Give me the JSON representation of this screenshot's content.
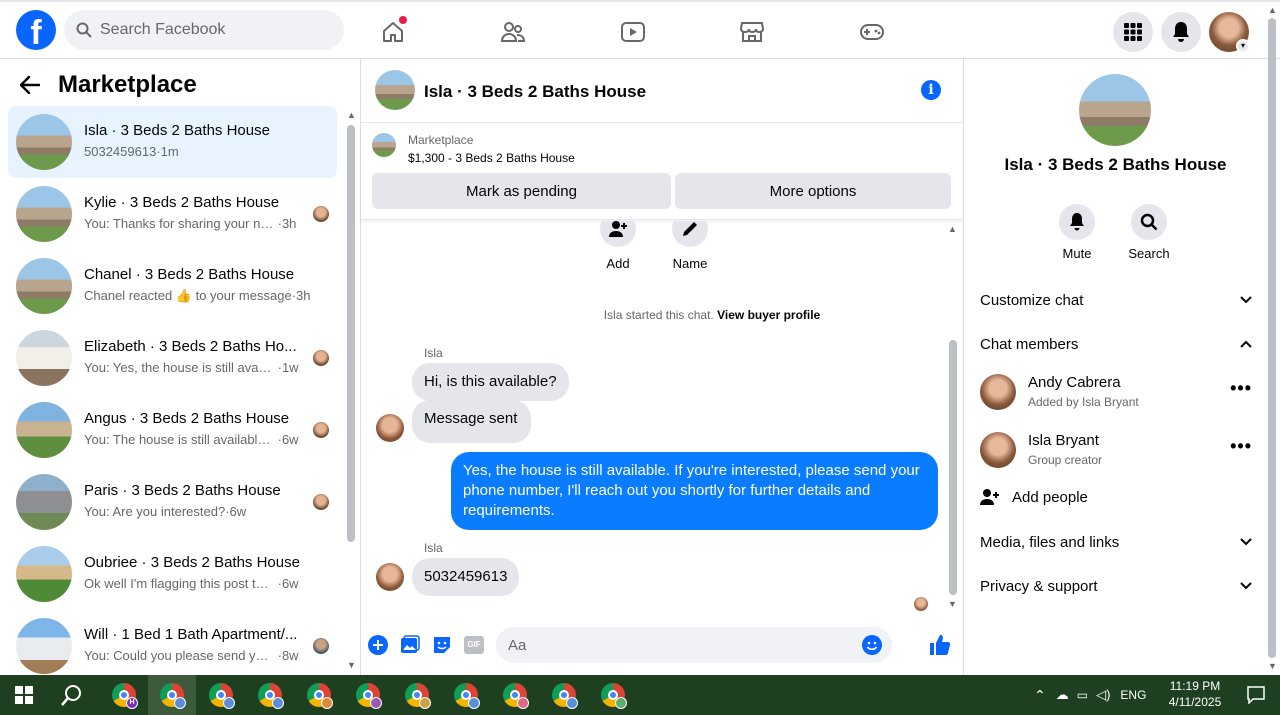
{
  "header": {
    "search_placeholder": "Search Facebook",
    "nav_icons": [
      "home-icon",
      "friends-icon",
      "video-icon",
      "marketplace-icon",
      "gaming-icon"
    ],
    "right_icons": [
      "menu-grid-icon",
      "notifications-icon",
      "account-avatar"
    ]
  },
  "left": {
    "title": "Marketplace",
    "conversations": [
      {
        "title": "Isla · 3 Beds 2 Baths House",
        "preview": "5032459613",
        "time": "1m",
        "active": true
      },
      {
        "title": "Kylie · 3 Beds 2 Baths House",
        "preview": "You: Thanks for sharing your nu...",
        "time": "3h"
      },
      {
        "title": "Chanel · 3 Beds 2 Baths House",
        "preview": "Chanel reacted 👍 to your message",
        "time": "3h"
      },
      {
        "title": "Elizabeth · 3 Beds 2 Baths Ho...",
        "preview": "You: Yes, the house is still availa...",
        "time": "1w"
      },
      {
        "title": "Angus · 3 Beds 2 Baths House",
        "preview": "You: The house is still available. I...",
        "time": "6w"
      },
      {
        "title": "Paris · 3 Beds 2 Baths House",
        "preview": "You: Are you interested?",
        "time": "6w"
      },
      {
        "title": "Oubriee · 3 Beds 2 Baths House",
        "preview": "Ok well I'm flagging this post there...",
        "time": "6w"
      },
      {
        "title": "Will · 1 Bed 1 Bath Apartment/...",
        "preview": "You: Could you please send you...",
        "time": "8w"
      }
    ]
  },
  "chat": {
    "title": "Isla · 3 Beds 2 Baths House",
    "listing_label": "Marketplace",
    "listing_item": "$1,300 - 3 Beds 2 Baths House",
    "btn_pending": "Mark as pending",
    "btn_more": "More options",
    "action_add": "Add",
    "action_name": "Name",
    "system_prefix": "Isla started this chat.",
    "system_link": "View buyer profile",
    "sender1": "Isla",
    "msg1": "Hi, is this available?",
    "msg2": "Message sent",
    "msg3": "Yes, the house is still available. If you're interested, please send your phone number, I'll reach out you shortly for further details and requirements.",
    "sender2": "Isla",
    "msg4": "5032459613",
    "input_placeholder": "Aa",
    "composer_gif": "GIF"
  },
  "right": {
    "title": "Isla · 3 Beds 2 Baths House",
    "mute": "Mute",
    "search": "Search",
    "customize": "Customize chat",
    "members_heading": "Chat members",
    "members": [
      {
        "name": "Andy Cabrera",
        "sub": "Added by Isla Bryant"
      },
      {
        "name": "Isla Bryant",
        "sub": "Group creator"
      }
    ],
    "add_people": "Add people",
    "media": "Media, files and links",
    "privacy": "Privacy & support"
  },
  "taskbar": {
    "time": "11:19 PM",
    "date": "4/11/2025",
    "lang": "ENG",
    "badges": [
      "H",
      "",
      "",
      "",
      "",
      "",
      "",
      "",
      "",
      "",
      ""
    ]
  },
  "colors": {
    "brand": "#0866ff",
    "outgoing_bubble": "#0a7cff",
    "active_row": "#e7f3ff"
  }
}
